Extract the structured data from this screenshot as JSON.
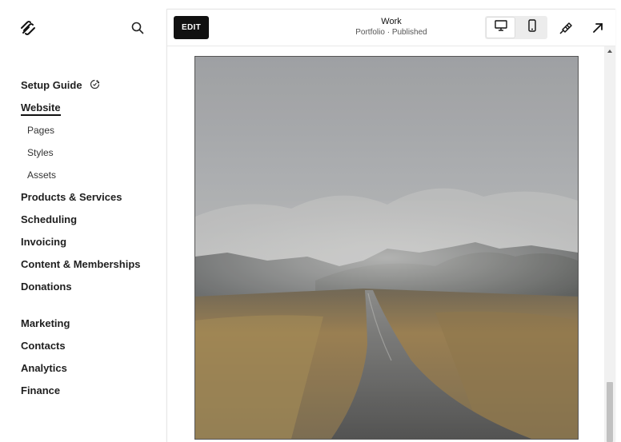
{
  "sidebar": {
    "logo_icon": "squarespace-logo-icon",
    "search_icon": "search-icon",
    "setup_guide": {
      "label": "Setup Guide",
      "icon": "progress-ring-icon"
    },
    "items": [
      {
        "label": "Website",
        "active": true
      },
      {
        "label": "Pages",
        "sub": true
      },
      {
        "label": "Styles",
        "sub": true
      },
      {
        "label": "Assets",
        "sub": true
      },
      {
        "label": "Products & Services"
      },
      {
        "label": "Scheduling"
      },
      {
        "label": "Invoicing"
      },
      {
        "label": "Content & Memberships"
      },
      {
        "label": "Donations"
      }
    ],
    "items2": [
      {
        "label": "Marketing"
      },
      {
        "label": "Contacts"
      },
      {
        "label": "Analytics"
      },
      {
        "label": "Finance"
      }
    ]
  },
  "topbar": {
    "edit_label": "EDIT",
    "page_title": "Work",
    "page_status": "Portfolio · Published",
    "device_modes": [
      "desktop-icon",
      "mobile-icon"
    ],
    "active_device": "desktop",
    "tools": [
      "brush-icon",
      "open-external-icon"
    ]
  },
  "preview": {
    "image": "foggy-mountain-road-photo"
  },
  "colors": {
    "edit_bg": "#111111",
    "canvas_bg": "#f7f7f7",
    "toggle_bg": "#ececec"
  }
}
